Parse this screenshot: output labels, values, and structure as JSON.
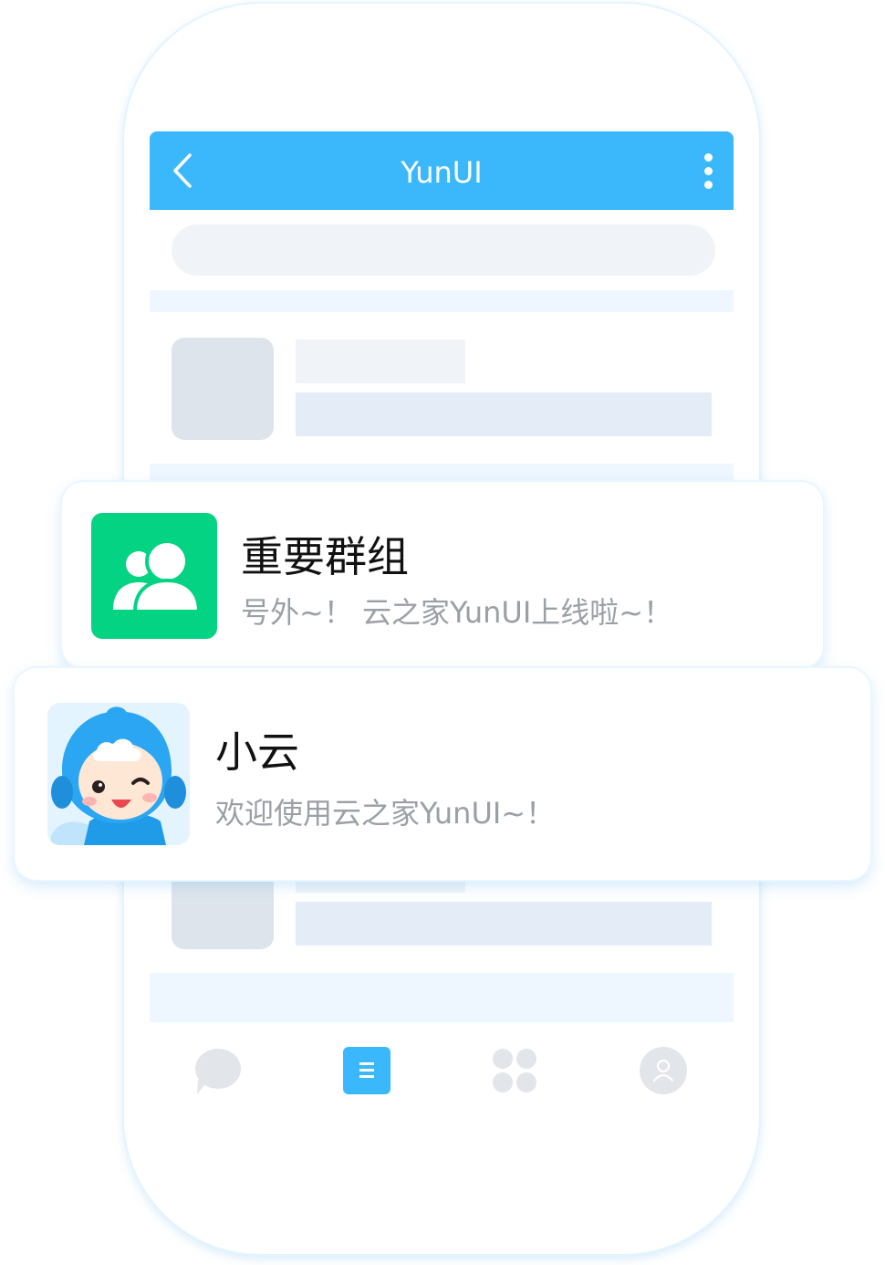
{
  "header": {
    "title": "YunUI",
    "background_color": "#3bb8fb",
    "back_icon": "chevron-left-icon",
    "more_icon": "vertical-ellipsis-icon"
  },
  "tabbar": {
    "tabs": [
      {
        "icon": "chat-bubble-icon",
        "active": false
      },
      {
        "icon": "document-list-icon",
        "active": true
      },
      {
        "icon": "apps-grid-icon",
        "active": false
      },
      {
        "icon": "user-profile-icon",
        "active": false
      }
    ],
    "active_color": "#3bb8fb",
    "inactive_color": "#e2e5ea"
  },
  "messages": [
    {
      "title": "重要群组",
      "subtitle": "号外~！ 云之家YunUI上线啦~！",
      "avatar_icon": "group-users-icon",
      "avatar_color": "#03d382"
    },
    {
      "title": "小云",
      "subtitle": "欢迎使用云之家YunUI~！",
      "avatar_icon": "mascot-avatar-icon"
    }
  ]
}
